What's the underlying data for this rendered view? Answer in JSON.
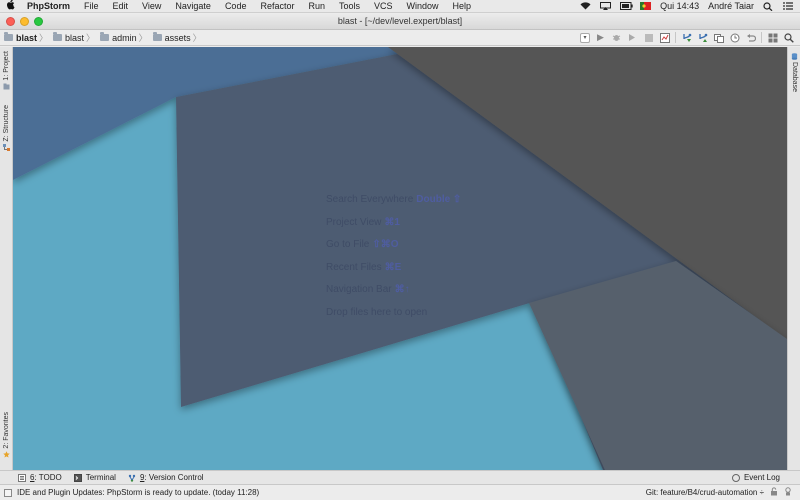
{
  "menubar": {
    "apple": "",
    "app_name": "PhpStorm",
    "items": [
      "File",
      "Edit",
      "View",
      "Navigate",
      "Code",
      "Refactor",
      "Run",
      "Tools",
      "VCS",
      "Window",
      "Help"
    ],
    "clock": "Qui 14:43",
    "user": "André Taiar"
  },
  "window": {
    "title": "blast - [~/dev/level.expert/blast]"
  },
  "breadcrumbs": [
    "blast",
    "blast",
    "admin",
    "assets"
  ],
  "left_tools": {
    "project": "1: Project",
    "structure": "Z: Structure",
    "favorites": "2: Favorites"
  },
  "right_tools": {
    "database": "Database"
  },
  "editor": {
    "hints": [
      {
        "label": "Search Everywhere",
        "key": "Double ⇧"
      },
      {
        "label": "Project View",
        "key": "⌘1"
      },
      {
        "label": "Go to File",
        "key": "⇧⌘O"
      },
      {
        "label": "Recent Files",
        "key": "⌘E"
      },
      {
        "label": "Navigation Bar",
        "key": "⌘↑"
      },
      {
        "label": "Drop files here to open",
        "key": ""
      }
    ],
    "colors": {
      "background": "#5ea9c4",
      "upper_left": "#4c6e95",
      "center": "#4d5b72",
      "dark": "#555555",
      "lower_right": "#56606c"
    }
  },
  "bottom_tabs": {
    "todo_num": "6",
    "todo_rest": ": TODO",
    "terminal": "Terminal",
    "vc_num": "9",
    "vc_rest": ": Version Control",
    "event_log": "Event Log"
  },
  "status": {
    "message": "IDE and Plugin Updates: PhpStorm is ready to update. (today 11:28)",
    "git": "Git: feature/B4/crud-automation ÷"
  }
}
